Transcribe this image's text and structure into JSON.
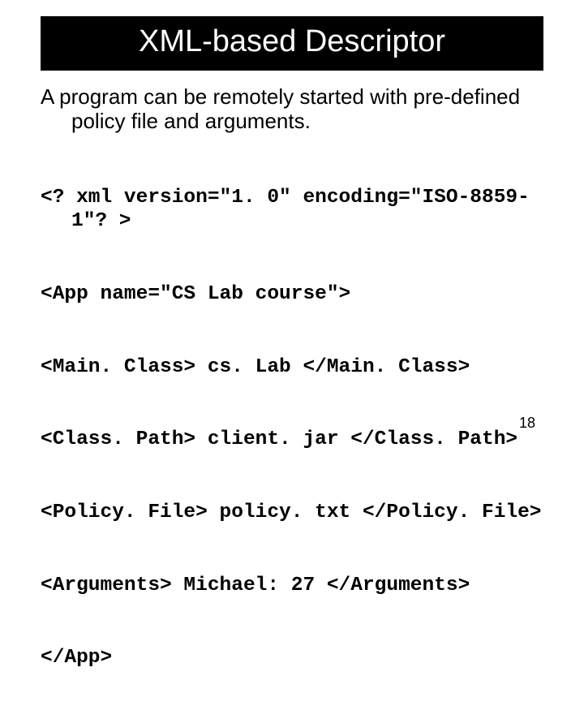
{
  "title": "XML-based Descriptor",
  "intro": "A program can be remotely started with pre-defined policy file and arguments.",
  "xml": {
    "l1": "<? xml version=\"1. 0\" encoding=\"ISO-8859-1\"? >",
    "l2": "<App name=\"CS Lab course\">",
    "l3": "<Main. Class> cs. Lab </Main. Class>",
    "l4": "<Class. Path> client. jar </Class. Path>",
    "l5": "<Policy. File> policy. txt </Policy. File>",
    "l6": "<Arguments> Michael: 27 </Arguments>",
    "l7": "</App>"
  },
  "page_number": "18"
}
